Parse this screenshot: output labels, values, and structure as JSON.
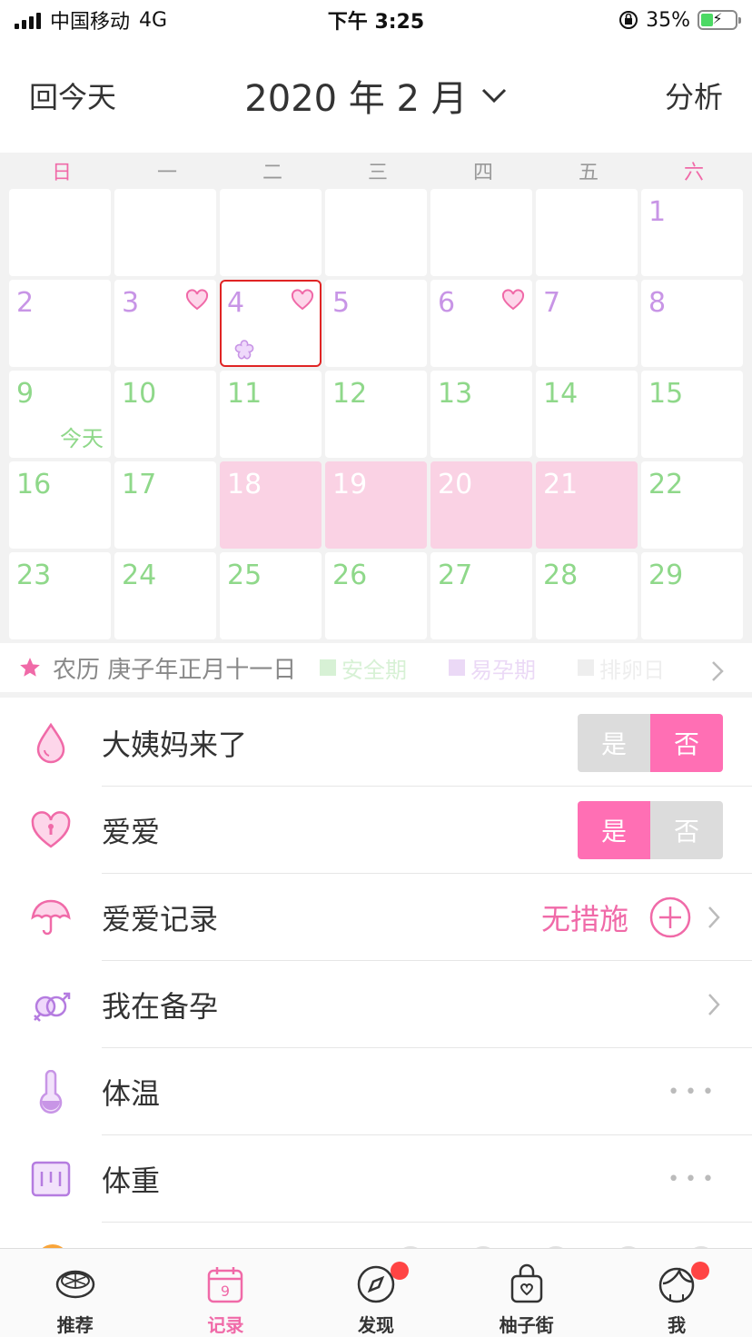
{
  "status_bar": {
    "carrier": "中国移动",
    "network": "4G",
    "time": "下午 3:25",
    "battery": "35%"
  },
  "header": {
    "back_label": "回今天",
    "title": "2020 年 2 月",
    "analyze_label": "分析"
  },
  "calendar": {
    "weekdays": [
      "日",
      "一",
      "二",
      "三",
      "四",
      "五",
      "六"
    ],
    "today_label": "今天",
    "days": [
      {
        "d": "",
        "c": "empty"
      },
      {
        "d": "",
        "c": "empty"
      },
      {
        "d": "",
        "c": "empty"
      },
      {
        "d": "",
        "c": "empty"
      },
      {
        "d": "",
        "c": "empty"
      },
      {
        "d": "",
        "c": "empty"
      },
      {
        "d": "1",
        "c": "purple"
      },
      {
        "d": "2",
        "c": "purple"
      },
      {
        "d": "3",
        "c": "purple",
        "heart": true
      },
      {
        "d": "4",
        "c": "purple",
        "heart": true,
        "flower": true,
        "selected": true
      },
      {
        "d": "5",
        "c": "purple"
      },
      {
        "d": "6",
        "c": "purple",
        "heart": true
      },
      {
        "d": "7",
        "c": "purple"
      },
      {
        "d": "8",
        "c": "purple"
      },
      {
        "d": "9",
        "c": "green",
        "today": true
      },
      {
        "d": "10",
        "c": "green"
      },
      {
        "d": "11",
        "c": "green"
      },
      {
        "d": "12",
        "c": "green"
      },
      {
        "d": "13",
        "c": "green"
      },
      {
        "d": "14",
        "c": "green"
      },
      {
        "d": "15",
        "c": "green"
      },
      {
        "d": "16",
        "c": "green"
      },
      {
        "d": "17",
        "c": "green"
      },
      {
        "d": "18",
        "c": "period"
      },
      {
        "d": "19",
        "c": "period"
      },
      {
        "d": "20",
        "c": "period"
      },
      {
        "d": "21",
        "c": "period"
      },
      {
        "d": "22",
        "c": "green"
      },
      {
        "d": "23",
        "c": "green"
      },
      {
        "d": "24",
        "c": "green"
      },
      {
        "d": "25",
        "c": "green"
      },
      {
        "d": "26",
        "c": "green"
      },
      {
        "d": "27",
        "c": "green"
      },
      {
        "d": "28",
        "c": "green"
      },
      {
        "d": "29",
        "c": "green"
      }
    ]
  },
  "lunar": {
    "text": "农历 庚子年正月十一日",
    "legend": [
      {
        "label": "安全期",
        "color": "#8fd88a"
      },
      {
        "label": "易孕期",
        "color": "#c895e6"
      },
      {
        "label": "排卵日",
        "color": "#d0d0d0"
      }
    ]
  },
  "records": {
    "period": {
      "label": "大姨妈来了",
      "yes": "是",
      "no": "否",
      "selected": "no"
    },
    "love": {
      "label": "爱爱",
      "yes": "是",
      "no": "否",
      "selected": "yes"
    },
    "love_record": {
      "label": "爱爱记录",
      "value": "无措施"
    },
    "pregnancy_prep": {
      "label": "我在备孕"
    },
    "temperature": {
      "label": "体温"
    },
    "weight": {
      "label": "体重"
    }
  },
  "tabs": [
    {
      "label": "推荐",
      "badge": false,
      "active": false
    },
    {
      "label": "记录",
      "badge": false,
      "active": true,
      "day": "9"
    },
    {
      "label": "发现",
      "badge": true,
      "active": false
    },
    {
      "label": "柚子街",
      "badge": false,
      "active": false
    },
    {
      "label": "我",
      "badge": true,
      "active": false
    }
  ],
  "colors": {
    "accent": "#f06aa8",
    "toggle_on": "#ff6fb4",
    "period_bg": "#fad2e4",
    "safe": "#8fd88a",
    "fertile": "#c895e6"
  }
}
